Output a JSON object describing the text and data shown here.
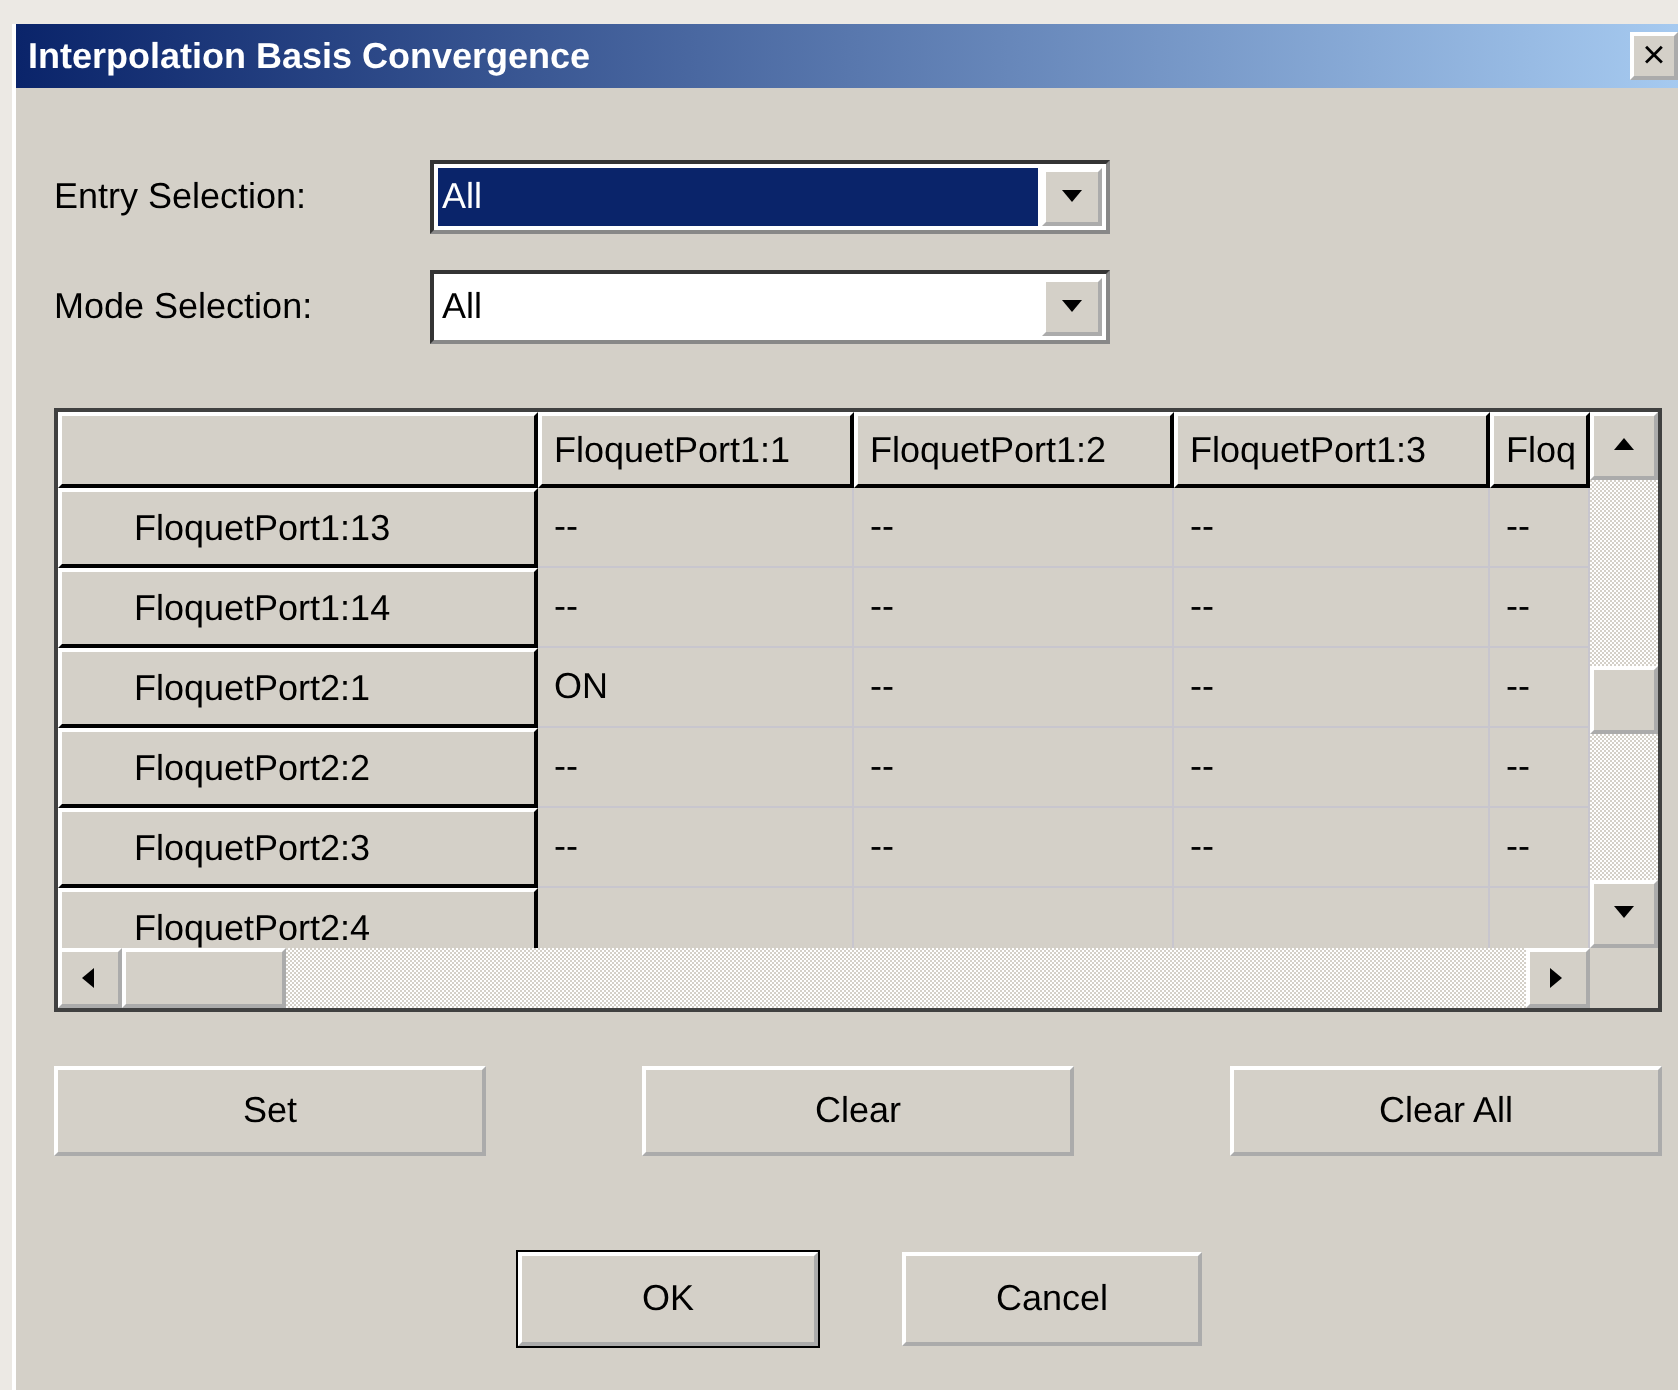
{
  "window": {
    "title": "Interpolation Basis Convergence",
    "close": "×"
  },
  "selectors": [
    {
      "label": "Entry Selection:",
      "value": "All",
      "focused": true
    },
    {
      "label": "Mode Selection:",
      "value": "All",
      "focused": false
    }
  ],
  "table": {
    "columns": [
      "FloquetPort1:1",
      "FloquetPort1:2",
      "FloquetPort1:3",
      "Floq"
    ],
    "rows": [
      {
        "header": "FloquetPort1:13",
        "cells": [
          "--",
          "--",
          "--",
          "--"
        ]
      },
      {
        "header": "FloquetPort1:14",
        "cells": [
          "--",
          "--",
          "--",
          "--"
        ]
      },
      {
        "header": "FloquetPort2:1",
        "cells": [
          "ON",
          "--",
          "--",
          "--"
        ]
      },
      {
        "header": "FloquetPort2:2",
        "cells": [
          "--",
          "--",
          "--",
          "--"
        ]
      },
      {
        "header": "FloquetPort2:3",
        "cells": [
          "--",
          "--",
          "--",
          "--"
        ]
      },
      {
        "header": "FloquetPort2:4"
      }
    ]
  },
  "actions": [
    {
      "label": "Set"
    },
    {
      "label": "Clear"
    },
    {
      "label": "Clear All"
    }
  ],
  "buttons": [
    {
      "label": "OK",
      "default": true
    },
    {
      "label": "Cancel",
      "default": false
    }
  ]
}
